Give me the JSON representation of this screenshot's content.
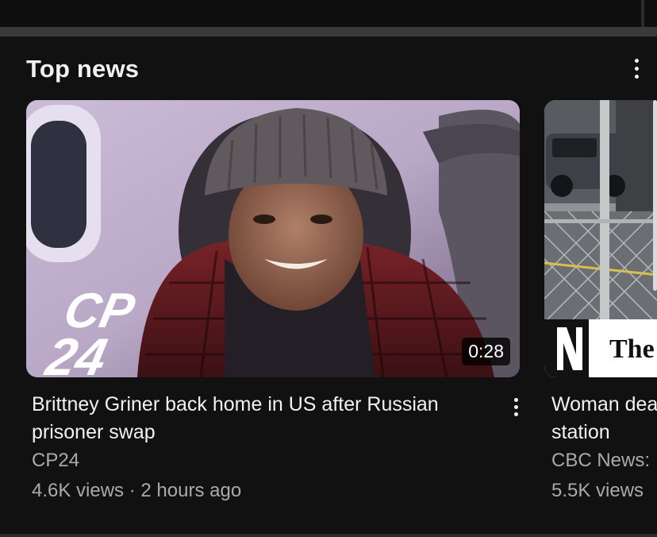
{
  "section": {
    "title": "Top news"
  },
  "videos": [
    {
      "title": "Brittney Griner back home in US after Russian prisoner swap",
      "channel": "CP24",
      "views": "4.6K views",
      "age": "2 hours ago",
      "duration": "0:28",
      "thumbnail_logo": "CP24"
    },
    {
      "title": "Woman dea station",
      "title_line1": "Woman dea",
      "title_line2": "station",
      "channel": "CBC News:",
      "views": "5.5K views",
      "thumbnail_logo": "The"
    }
  ],
  "icons": {
    "section_menu": "more-vertical-icon",
    "card_menu": "more-vertical-icon"
  },
  "colors": {
    "background": "#0f0f0f",
    "text_primary": "#f1f1f1",
    "text_secondary": "#aaaaaa"
  }
}
